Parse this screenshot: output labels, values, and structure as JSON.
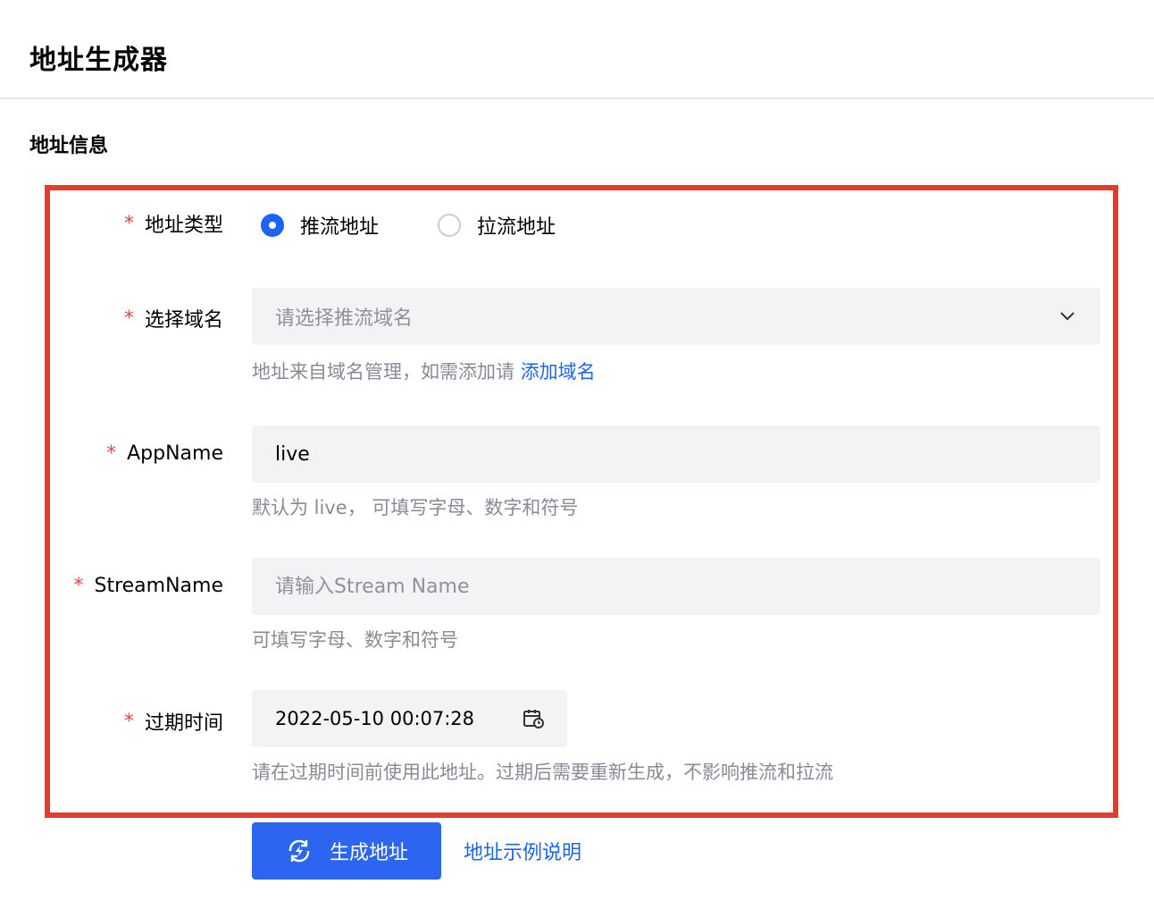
{
  "page": {
    "title": "地址生成器",
    "section_title": "地址信息"
  },
  "form": {
    "required_mark": "*",
    "address_type": {
      "label": "地址类型",
      "options": [
        {
          "label": "推流地址",
          "checked": true
        },
        {
          "label": "拉流地址",
          "checked": false
        }
      ]
    },
    "domain": {
      "label": "选择域名",
      "placeholder": "请选择推流域名",
      "hint": "地址来自域名管理，如需添加请",
      "hint_link": "添加域名"
    },
    "app_name": {
      "label": "AppName",
      "value": "live",
      "hint": "默认为 live， 可填写字母、数字和符号"
    },
    "stream_name": {
      "label": "StreamName",
      "placeholder": "请输入Stream Name",
      "hint": "可填写字母、数字和符号"
    },
    "expire_time": {
      "label": "过期时间",
      "value": "2022-05-10 00:07:28",
      "hint": "请在过期时间前使用此地址。过期后需要重新生成，不影响推流和拉流"
    }
  },
  "actions": {
    "generate_label": "生成地址",
    "example_link": "地址示例说明"
  },
  "colors": {
    "primary": "#1d64f5",
    "button": "#2c66f0",
    "highlight_border": "#e53b2b",
    "required": "#e54545",
    "field_bg": "#f2f3f5",
    "hint": "#868b96"
  }
}
